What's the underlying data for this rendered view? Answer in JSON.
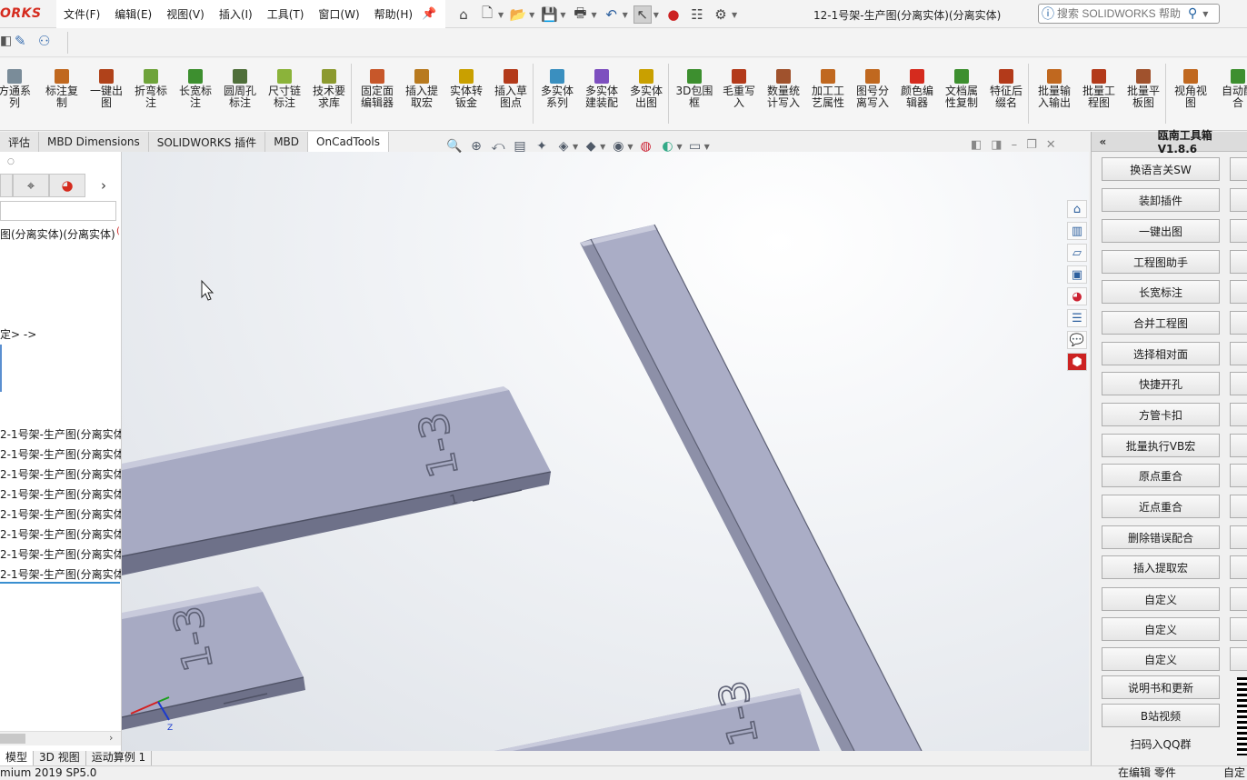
{
  "app": {
    "logo": "ORKS",
    "document_title": "12-1号架-生产图(分离实体)(分离实体)"
  },
  "menu": [
    "文件(F)",
    "编辑(E)",
    "视图(V)",
    "插入(I)",
    "工具(T)",
    "窗口(W)",
    "帮助(H)"
  ],
  "help_search": {
    "placeholder": "搜索 SOLIDWORKS 帮助"
  },
  "quick_toolbar_icons": [
    "home-icon",
    "new-doc-icon",
    "open-icon",
    "save-icon",
    "print-icon",
    "undo-icon",
    "select-icon",
    "traffic-light-icon",
    "file-properties-icon",
    "options-gear-icon"
  ],
  "command_manager": [
    {
      "label": "方通系\n列",
      "icon": "tube-series-icon",
      "color": "#7a8c99"
    },
    {
      "label": "标注复\n制",
      "icon": "dim-copy-icon",
      "color": "#c0681f"
    },
    {
      "label": "一键出\n图",
      "icon": "one-click-drawing-icon",
      "color": "#b0421a"
    },
    {
      "label": "折弯标\n注",
      "icon": "bend-note-icon",
      "color": "#6ea33a"
    },
    {
      "label": "长宽标\n注",
      "icon": "lw-dim-icon",
      "color": "#3d8f2f"
    },
    {
      "label": "圆周孔\n标注",
      "icon": "circle-hole-icon",
      "color": "#4f6f3a"
    },
    {
      "label": "尺寸链\n标注",
      "icon": "dim-chain-icon",
      "color": "#8bb33a"
    },
    {
      "label": "技术要\n求库",
      "icon": "tech-req-icon",
      "color": "#8c9a2f"
    },
    {
      "label": "固定面\n编辑器",
      "icon": "fixed-face-icon",
      "color": "#c7572a"
    },
    {
      "label": "插入提\n取宏",
      "icon": "insert-macro-icon",
      "color": "#b87a1f"
    },
    {
      "label": "实体转\n钣金",
      "icon": "body-sheetmetal-icon",
      "color": "#c9a000"
    },
    {
      "label": "插入草\n图点",
      "icon": "sketch-point-icon",
      "color": "#b33a1a"
    },
    {
      "label": "多实体\n系列",
      "icon": "multibody-series-icon",
      "color": "#3a8fbf"
    },
    {
      "label": "多实体\n建装配",
      "icon": "multibody-assembly-icon",
      "color": "#7d4fbf"
    },
    {
      "label": "多实体\n出图",
      "icon": "multibody-drawing-icon",
      "color": "#c9a000"
    },
    {
      "label": "3D包围\n框",
      "icon": "bounding-box-icon",
      "color": "#3d8f2f"
    },
    {
      "label": "毛重写\n入",
      "icon": "gross-weight-icon",
      "color": "#b33a1a"
    },
    {
      "label": "数量统\n计写入",
      "icon": "quantity-count-icon",
      "color": "#a0522d"
    },
    {
      "label": "加工工\n艺属性",
      "icon": "process-attr-icon",
      "color": "#c0681f"
    },
    {
      "label": "图号分\n离写入",
      "icon": "drawing-no-split-icon",
      "color": "#c0681f"
    },
    {
      "label": "颜色编\n辑器",
      "icon": "color-editor-icon",
      "color": "#d52b1e"
    },
    {
      "label": "文档属\n性复制",
      "icon": "doc-prop-copy-icon",
      "color": "#3d8f2f"
    },
    {
      "label": "特征后\n缀名",
      "icon": "feature-suffix-icon",
      "color": "#b33a1a"
    },
    {
      "label": "批量输\n入输出",
      "icon": "batch-io-icon",
      "color": "#c0681f"
    },
    {
      "label": "批量工\n程图",
      "icon": "batch-drawing-icon",
      "color": "#b33a1a"
    },
    {
      "label": "批量平\n板图",
      "icon": "batch-flat-icon",
      "color": "#a0522d"
    },
    {
      "label": "视角视\n图",
      "icon": "view-angle-icon",
      "color": "#c0681f"
    },
    {
      "label": "自动配\n合",
      "icon": "auto-mate-icon",
      "color": "#3d8f2f"
    }
  ],
  "tabs": [
    {
      "label": "评估",
      "active": false
    },
    {
      "label": "MBD Dimensions",
      "active": false
    },
    {
      "label": "SOLIDWORKS 插件",
      "active": false
    },
    {
      "label": "MBD",
      "active": false
    },
    {
      "label": "OnCadTools",
      "active": true
    }
  ],
  "feature_tree": {
    "root": "图(分离实体)(分离实体)",
    "history_marker": "定> ->",
    "items": [
      "2-1号架-生产图(分离实体",
      "2-1号架-生产图(分离实体",
      "2-1号架-生产图(分离实体",
      "2-1号架-生产图(分离实体",
      "2-1号架-生产图(分离实体",
      "2-1号架-生产图(分离实体",
      "2-1号架-生产图(分离实体",
      "2-1号架-生产图(分离实体"
    ]
  },
  "model_labels": {
    "part_mark": "1-3",
    "part_mark_small": "1",
    "axis_z": "Z"
  },
  "bottom_tabs": [
    {
      "label": "模型",
      "active": true
    },
    {
      "label": "3D 视图",
      "active": false
    },
    {
      "label": "运动算例 1",
      "active": false
    }
  ],
  "status": {
    "version": "mium 2019 SP5.0",
    "editing": "在编辑 零件",
    "custom": "自定"
  },
  "toolbox": {
    "title": "瓯南工具箱V1.8.6",
    "buttons": [
      "换语言关SW",
      "装卸插件",
      "一键出图",
      "工程图助手",
      "长宽标注",
      "合并工程图",
      "选择相对面",
      "快捷开孔",
      "方管卡扣",
      "批量执行VB宏",
      "原点重合",
      "近点重合",
      "删除错误配合",
      "插入提取宏",
      "自定义",
      "自定义",
      "自定义",
      "说明书和更新",
      "B站视频",
      "扫码入QQ群"
    ]
  },
  "colors": {
    "beam_face": "#a9acc4",
    "beam_side": "#7e8199",
    "beam_edge": "#5d6074",
    "logo_red": "#d52b1e",
    "accent_blue": "#2c5f9e"
  }
}
